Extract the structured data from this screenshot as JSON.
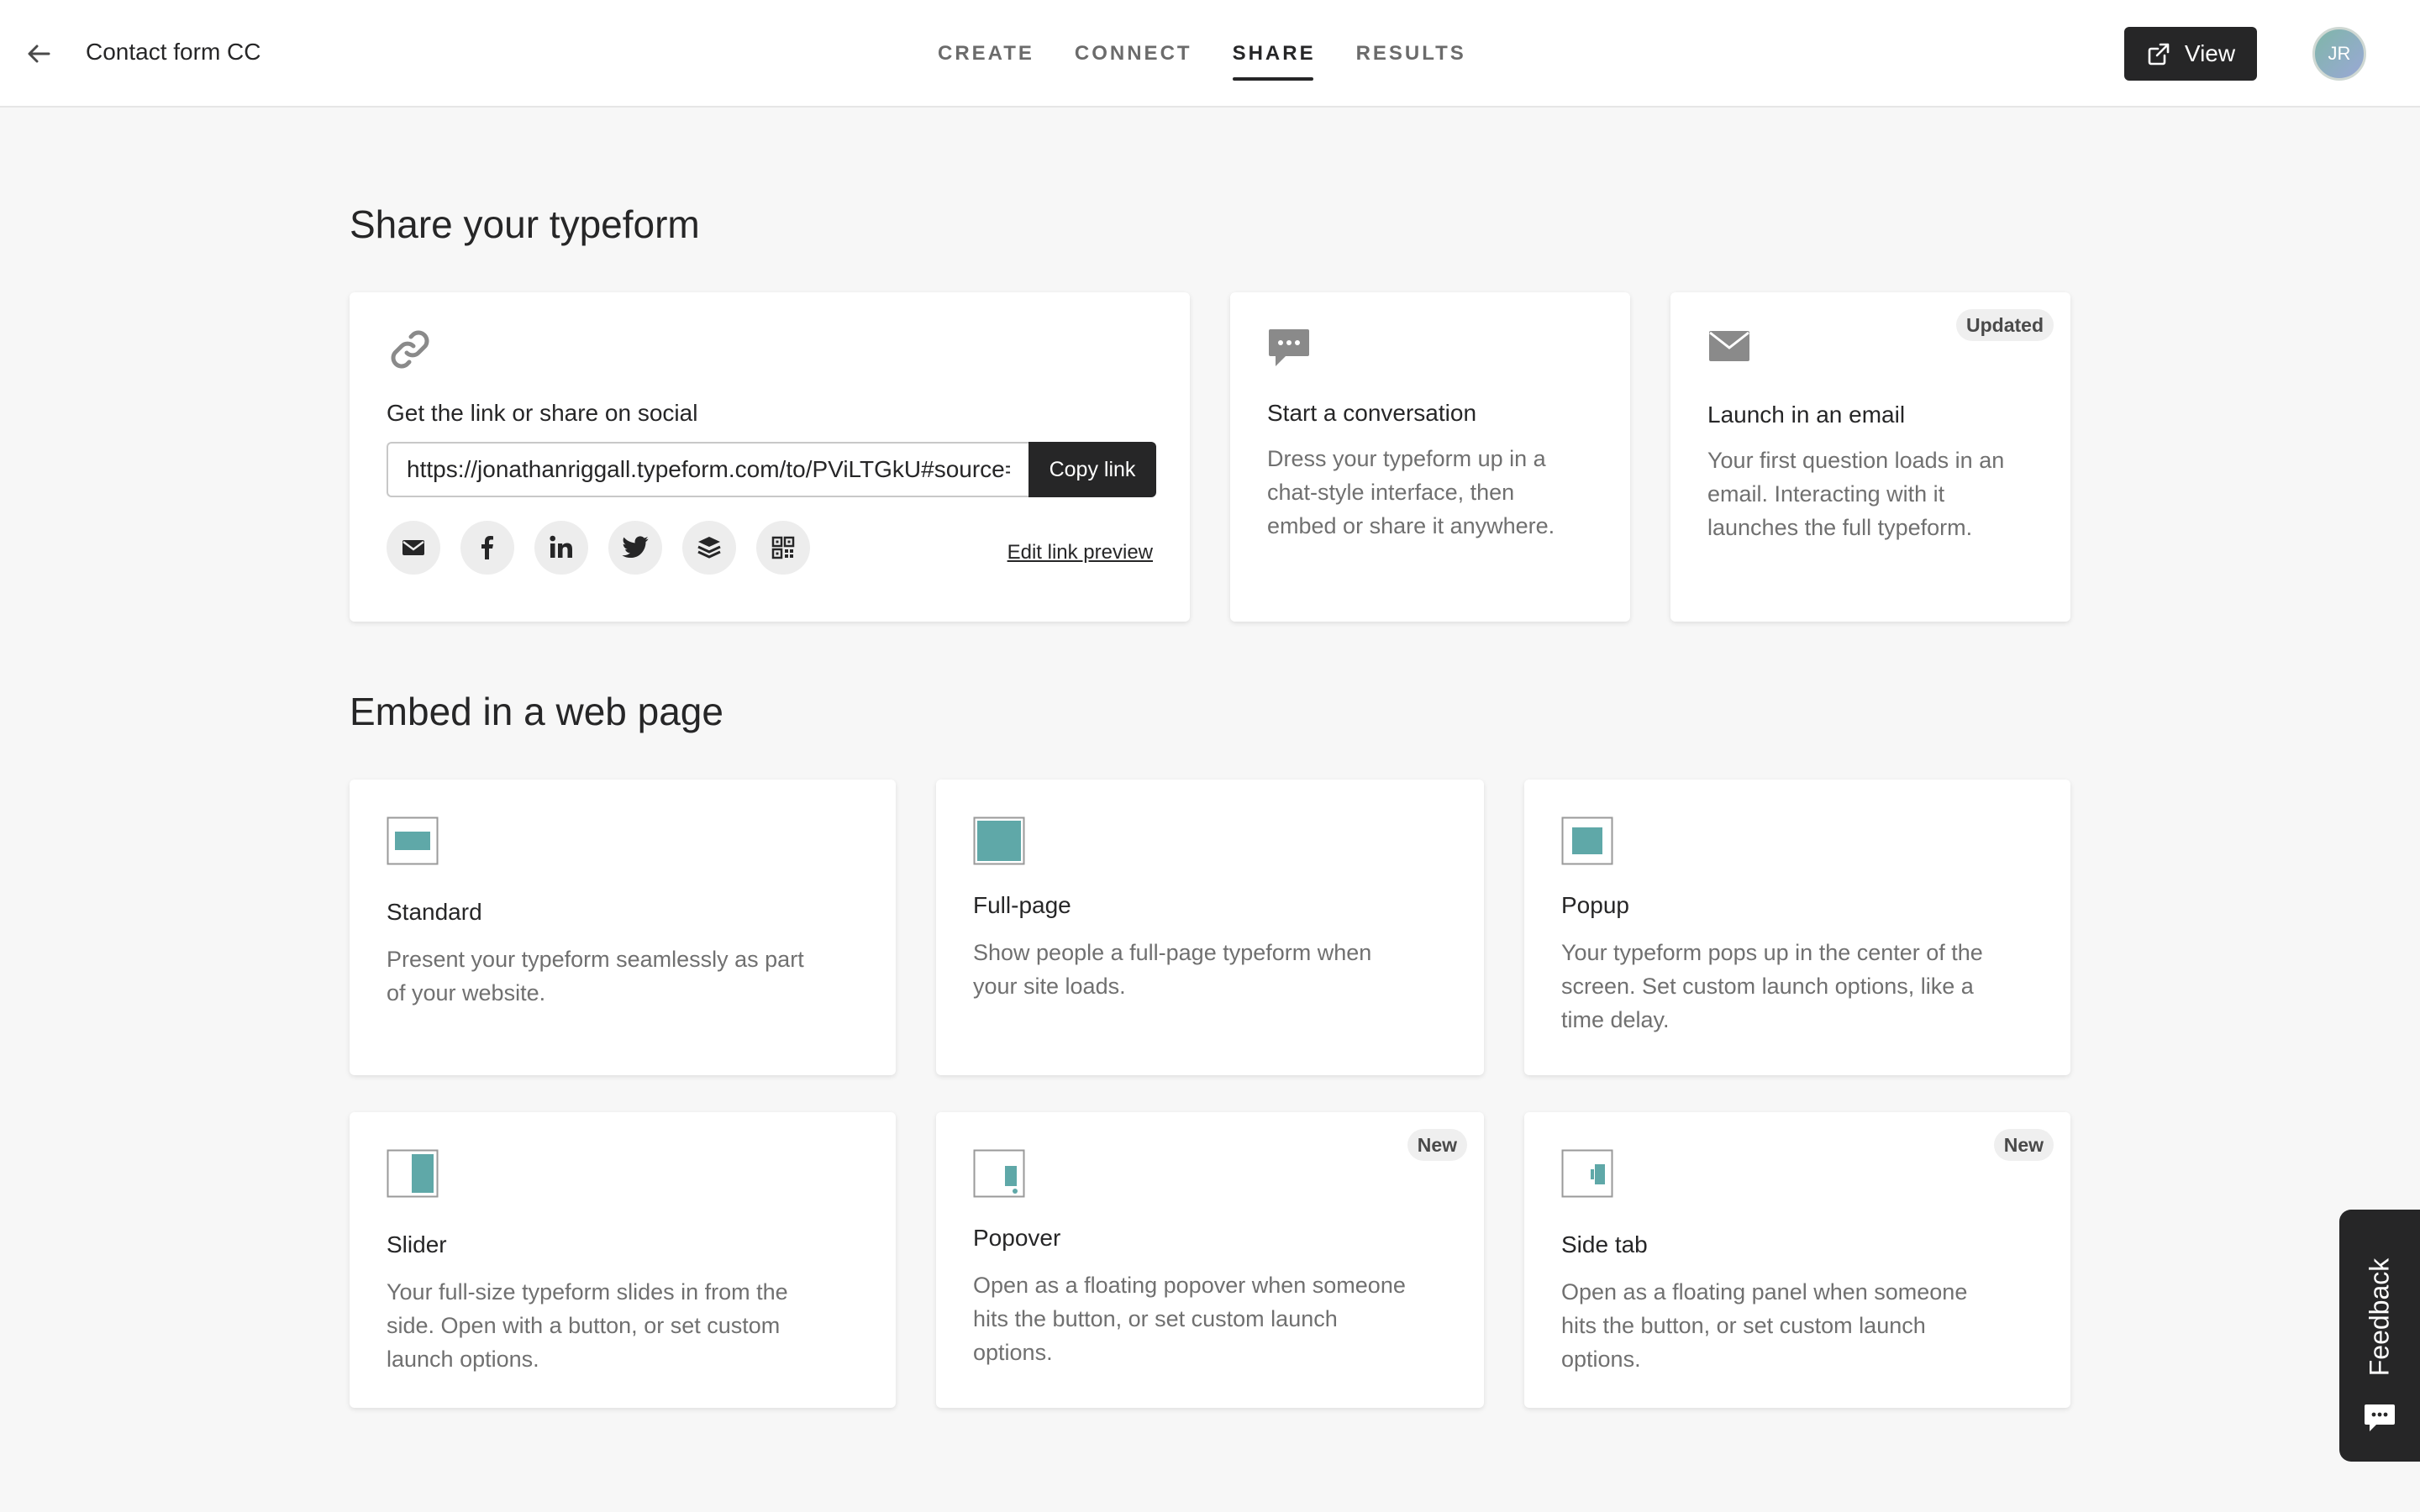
{
  "header": {
    "form_title": "Contact form CC",
    "tabs": [
      {
        "label": "CREATE",
        "active": false
      },
      {
        "label": "CONNECT",
        "active": false
      },
      {
        "label": "SHARE",
        "active": true
      },
      {
        "label": "RESULTS",
        "active": false
      }
    ],
    "view_label": "View",
    "avatar_initials": "JR"
  },
  "share": {
    "title": "Share your typeform",
    "link_card": {
      "title": "Get the link or share on social",
      "url": "https://jonathanriggall.typeform.com/to/PViLTGkU#source=xxxxx",
      "copy_label": "Copy link",
      "edit_preview_label": "Edit link preview",
      "social_icons": [
        "email-icon",
        "facebook-icon",
        "linkedin-icon",
        "twitter-icon",
        "buffer-icon",
        "qr-code-icon"
      ]
    },
    "conversation_card": {
      "title": "Start a conversation",
      "desc": [
        "Dress your typeform up in a",
        "chat-style interface, then",
        "embed or share it anywhere."
      ]
    },
    "email_card": {
      "badge": "Updated",
      "title": "Launch in an email",
      "desc": [
        "Your first question loads in an",
        "email. Interacting with it",
        "launches the full typeform."
      ]
    }
  },
  "embed": {
    "title": "Embed in a web page",
    "cards": [
      {
        "title": "Standard",
        "desc": [
          "Present your typeform seamlessly as part",
          "of your website."
        ],
        "badge": ""
      },
      {
        "title": "Full-page",
        "desc": [
          "Show people a full-page typeform when",
          "your site loads."
        ],
        "badge": ""
      },
      {
        "title": "Popup",
        "desc": [
          "Your typeform pops up in the center of the",
          "screen. Set custom launch options, like a",
          "time delay."
        ],
        "badge": ""
      },
      {
        "title": "Slider",
        "desc": [
          "Your full-size typeform slides in from the",
          "side. Open with a button, or set custom",
          "launch options."
        ],
        "badge": ""
      },
      {
        "title": "Popover",
        "desc": [
          "Open as a floating popover when someone",
          "hits the button, or set custom launch",
          "options."
        ],
        "badge": "New"
      },
      {
        "title": "Side tab",
        "desc": [
          "Open as a floating panel when someone",
          "hits the button, or set custom launch",
          "options."
        ],
        "badge": "New"
      }
    ]
  },
  "feedback_label": "Feedback",
  "colors": {
    "accent_teal": "#5fa8a8",
    "dark": "#262627",
    "muted_text": "#707070",
    "background": "#f7f7f7"
  }
}
